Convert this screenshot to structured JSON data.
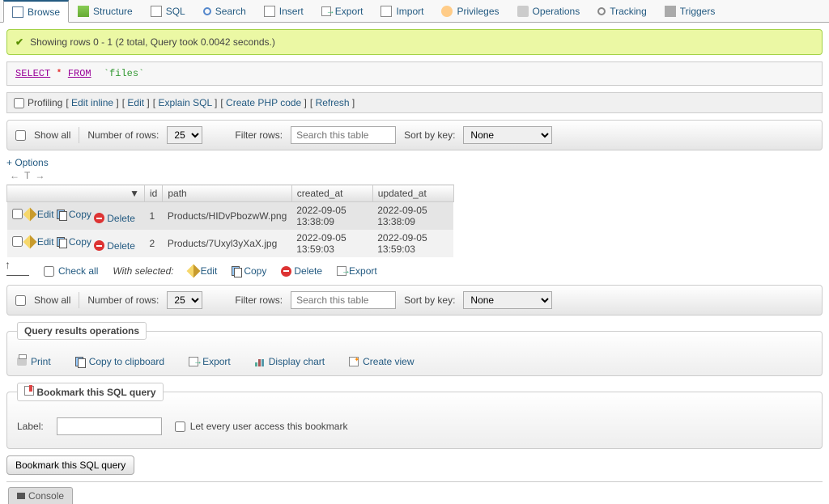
{
  "tabs": {
    "browse": "Browse",
    "structure": "Structure",
    "sql": "SQL",
    "search": "Search",
    "insert": "Insert",
    "export": "Export",
    "import": "Import",
    "privileges": "Privileges",
    "operations": "Operations",
    "tracking": "Tracking",
    "triggers": "Triggers"
  },
  "success_message": "Showing rows 0 - 1 (2 total, Query took 0.0042 seconds.)",
  "sql": {
    "kw1": "SELECT",
    "star": "*",
    "kw2": "FROM",
    "table": "`files`"
  },
  "profiling": {
    "label": "Profiling",
    "edit_inline": "Edit inline",
    "edit": "Edit",
    "explain": "Explain SQL",
    "create_php": "Create PHP code",
    "refresh": "Refresh"
  },
  "controls": {
    "show_all": "Show all",
    "num_rows_label": "Number of rows:",
    "rows_value": "25",
    "filter_label": "Filter rows:",
    "filter_placeholder": "Search this table",
    "sort_label": "Sort by key:",
    "sort_value": "None"
  },
  "options_link": "+ Options",
  "columns": {
    "id": "id",
    "path": "path",
    "created": "created_at",
    "updated": "updated_at"
  },
  "row_actions": {
    "edit": "Edit",
    "copy": "Copy",
    "delete": "Delete"
  },
  "rows": [
    {
      "id": "1",
      "path": "Products/HIDvPbozwW.png",
      "created": "2022-09-05 13:38:09",
      "updated": "2022-09-05 13:38:09"
    },
    {
      "id": "2",
      "path": "Products/7Uxyl3yXaX.jpg",
      "created": "2022-09-05 13:59:03",
      "updated": "2022-09-05 13:59:03"
    }
  ],
  "bulk": {
    "check_all": "Check all",
    "with_selected": "With selected:",
    "edit": "Edit",
    "copy": "Copy",
    "delete": "Delete",
    "export": "Export"
  },
  "results_ops": {
    "legend": "Query results operations",
    "print": "Print",
    "copy_clip": "Copy to clipboard",
    "export": "Export",
    "display_chart": "Display chart",
    "create_view": "Create view"
  },
  "bookmark": {
    "legend": "Bookmark this SQL query",
    "label": "Label:",
    "let_every": "Let every user access this bookmark",
    "button": "Bookmark this SQL query"
  },
  "console": "Console"
}
